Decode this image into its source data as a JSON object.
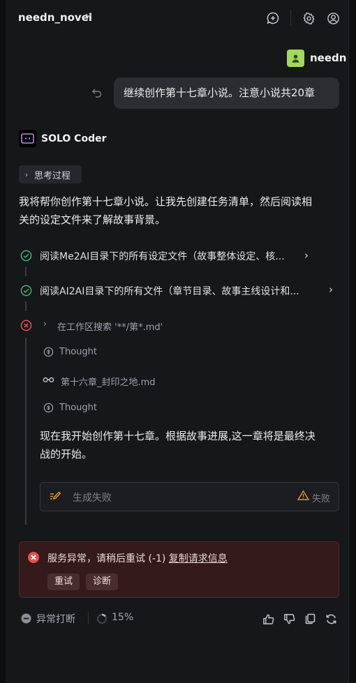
{
  "header": {
    "title": "needn_novel",
    "chevron": "▾"
  },
  "user": {
    "name": "needn",
    "message": "继续创作第十七章小说。注意小说共20章"
  },
  "assistant": {
    "name": "SOLO Coder",
    "thinking_label": "思考过程",
    "intro": [
      "我将帮你创作第十七章小说。让我先创建任务清单，然后阅读相",
      "关的设定文件来了解故事背景。"
    ],
    "steps": [
      {
        "status": "success",
        "text": "阅读Me2AI目录下的所有设定文件（故事整体设定、核..."
      },
      {
        "status": "success",
        "text": "阅读AI2AI目录下的所有文件（章节目录、故事主线设计和..."
      },
      {
        "status": "error",
        "text": "在工作区搜索 '**/第*.md'"
      }
    ],
    "substeps": [
      {
        "icon": "thought-icon",
        "text": "Thought"
      },
      {
        "icon": "glasses-icon",
        "text": "第十六章_封印之地.md"
      },
      {
        "icon": "thought-icon",
        "text": "Thought"
      }
    ],
    "continuation": [
      "现在我开始创作第十七章。根据故事进展,这一章将是最终决",
      "战的开始。"
    ],
    "generation_failed": "生成失败",
    "failed_label": "失败"
  },
  "error": {
    "message": "服务异常，请稍后重试 (-1)",
    "link": "复制请求信息",
    "retry": "重试",
    "diagnose": "诊断"
  },
  "footer": {
    "status": "异常打断",
    "progress": "15%",
    "progress_value": 0.15
  },
  "colors": {
    "success": "#3fb27f",
    "error": "#e05255",
    "warning": "#e0953a",
    "avatar": "#a4d85c"
  }
}
